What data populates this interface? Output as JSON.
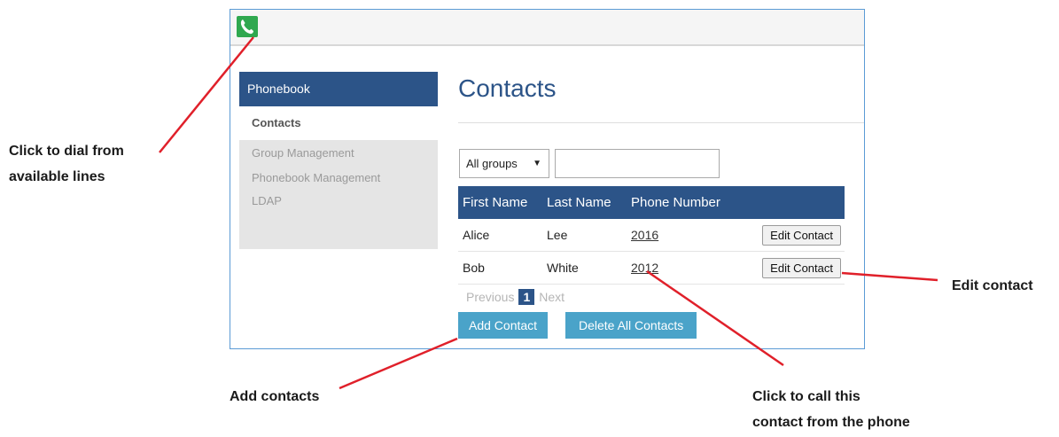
{
  "annotations": {
    "dial": [
      "Click to dial from",
      "available lines"
    ],
    "add": "Add contacts",
    "edit": "Edit contact",
    "call": [
      "Click to call this",
      "contact from the phone"
    ],
    "line_color": "#e0202a"
  },
  "app": {
    "sidebar": {
      "header": "Phonebook",
      "items": [
        {
          "label": "Contacts",
          "active": true
        },
        {
          "label": "Group Management",
          "active": false
        },
        {
          "label": "Phonebook Management",
          "active": false
        },
        {
          "label": "LDAP",
          "active": false
        }
      ]
    },
    "title": "Contacts",
    "filter": {
      "group_value": "All groups",
      "search_value": ""
    },
    "table": {
      "headers": [
        "First Name",
        "Last Name",
        "Phone Number",
        ""
      ],
      "rows": [
        {
          "first": "Alice",
          "last": "Lee",
          "phone": "2016",
          "action": "Edit Contact"
        },
        {
          "first": "Bob",
          "last": "White",
          "phone": "2012",
          "action": "Edit Contact"
        }
      ]
    },
    "pagination": {
      "previous": "Previous",
      "current": "1",
      "next": "Next"
    },
    "buttons": {
      "add": "Add Contact",
      "delete_all": "Delete All Contacts"
    }
  },
  "colors": {
    "brand_blue": "#2c5488",
    "accent_button": "#4aa3c9",
    "phone_icon_green": "#2fa84f"
  }
}
